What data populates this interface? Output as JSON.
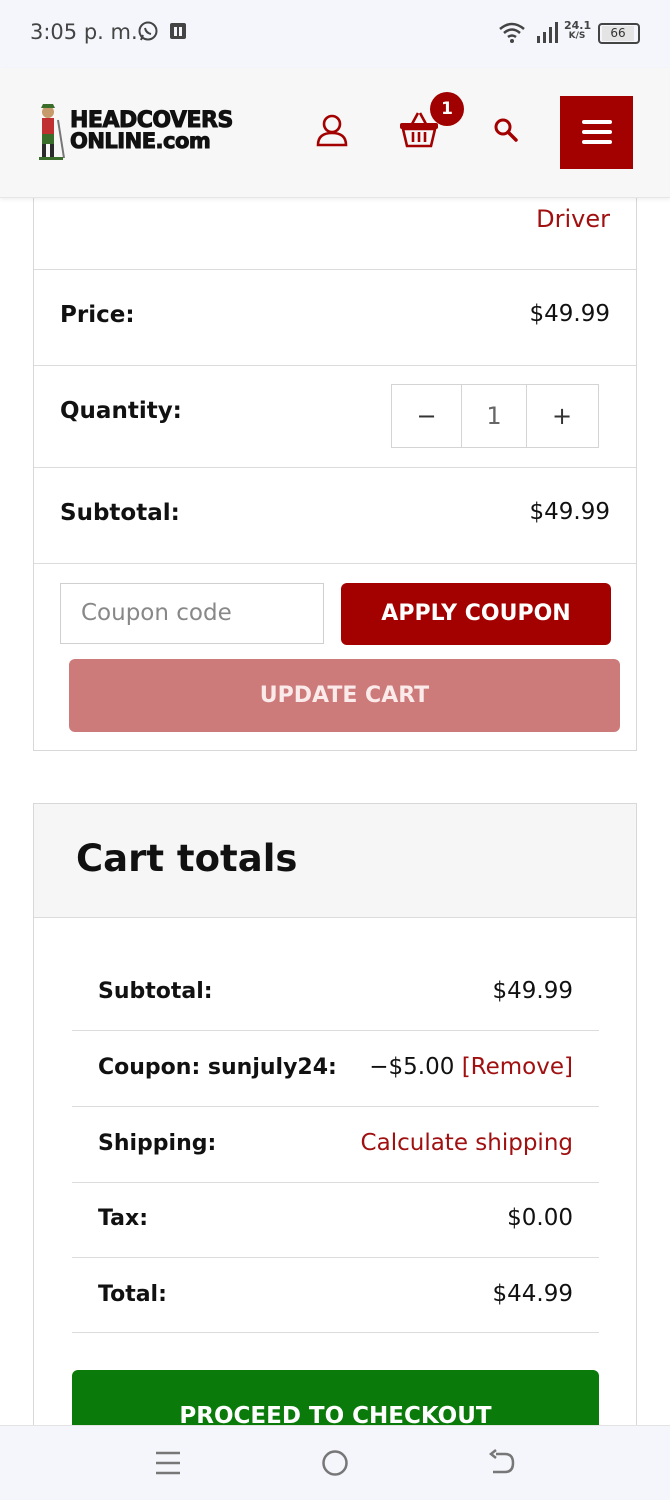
{
  "status_bar": {
    "time": "3:05 p. m.",
    "net_speed_value": "24.1",
    "net_speed_unit": "K/S",
    "battery": "66",
    "icons": [
      "whatsapp-icon",
      "app-notification-icon",
      "wifi-icon",
      "signal-icon",
      "battery-icon"
    ]
  },
  "header": {
    "logo_line1": "HEADCOVERS",
    "logo_line2": "ONLINE.com",
    "cart_count": "1",
    "icons": [
      "account-icon",
      "basket-icon",
      "search-icon",
      "hamburger-menu-icon"
    ]
  },
  "cart_item": {
    "variant": "Driver",
    "price_label": "Price:",
    "price": "$49.99",
    "quantity_label": "Quantity:",
    "quantity": "1",
    "minus": "−",
    "plus": "+",
    "subtotal_label": "Subtotal:",
    "subtotal": "$49.99",
    "coupon_placeholder": "Coupon code",
    "apply_coupon": "APPLY COUPON",
    "update_cart": "UPDATE CART"
  },
  "cart_totals": {
    "title": "Cart totals",
    "subtotal_label": "Subtotal:",
    "subtotal": "$49.99",
    "coupon_label": "Coupon: sunjuly24:",
    "coupon_discount": "−$5.00",
    "coupon_remove": "[Remove]",
    "shipping_label": "Shipping:",
    "shipping_link": "Calculate shipping",
    "tax_label": "Tax:",
    "tax": "$0.00",
    "total_label": "Total:",
    "total": "$44.99",
    "checkout": "PROCEED TO CHECKOUT"
  },
  "colors": {
    "brand_red": "#a30000",
    "update_disabled": "#cd7a7a",
    "checkout_green": "#0a7a0a",
    "link_red": "#a01010"
  }
}
